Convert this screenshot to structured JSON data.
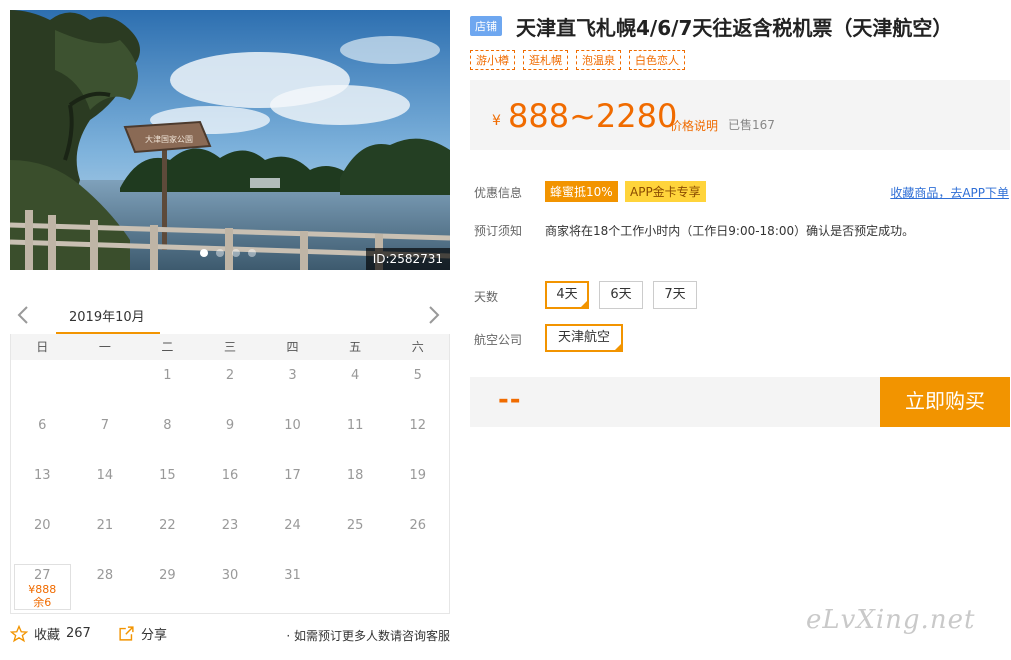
{
  "gallery": {
    "image_id": "ID:2582731",
    "sign_text": "大津国家公園",
    "slide_count": 4,
    "active_slide": 0
  },
  "calendar": {
    "month": "2019年10月",
    "weekdays": [
      "日",
      "一",
      "二",
      "三",
      "四",
      "五",
      "六"
    ],
    "cells": [
      {
        "day": ""
      },
      {
        "day": ""
      },
      {
        "day": "1"
      },
      {
        "day": "2"
      },
      {
        "day": "3"
      },
      {
        "day": "4"
      },
      {
        "day": "5"
      },
      {
        "day": "6"
      },
      {
        "day": "7"
      },
      {
        "day": "8"
      },
      {
        "day": "9"
      },
      {
        "day": "10"
      },
      {
        "day": "11"
      },
      {
        "day": "12"
      },
      {
        "day": "13"
      },
      {
        "day": "14"
      },
      {
        "day": "15"
      },
      {
        "day": "16"
      },
      {
        "day": "17"
      },
      {
        "day": "18"
      },
      {
        "day": "19"
      },
      {
        "day": "20"
      },
      {
        "day": "21"
      },
      {
        "day": "22"
      },
      {
        "day": "23"
      },
      {
        "day": "24"
      },
      {
        "day": "25"
      },
      {
        "day": "26"
      },
      {
        "day": "27",
        "price": "¥888",
        "left": "余6"
      },
      {
        "day": "28"
      },
      {
        "day": "29"
      },
      {
        "day": "30"
      },
      {
        "day": "31"
      },
      {
        "day": ""
      },
      {
        "day": ""
      }
    ]
  },
  "actions": {
    "collect_label": "收藏",
    "collect_count": "267",
    "share_label": "分享",
    "note": "· 如需预订更多人数请咨询客服"
  },
  "product": {
    "shop_badge": "店铺",
    "title": "天津直飞札幌4/6/7天往返含税机票（天津航空）",
    "tags": [
      "游小樽",
      "逛札幌",
      "泡温泉",
      "白色恋人"
    ],
    "currency": "¥",
    "price_range": "888~2280",
    "price_explain": "价格说明",
    "sold": "已售167"
  },
  "promo": {
    "label": "优惠信息",
    "bee_tag": "蜂蜜抵10%",
    "app_tag": "APP金卡专享",
    "app_link": "收藏商品，去APP下单"
  },
  "booking": {
    "label": "预订须知",
    "notice": "商家将在18个工作小时内（工作日9:00-18:00）确认是否预定成功。"
  },
  "options": {
    "days_label": "天数",
    "days": [
      {
        "label": "4天",
        "selected": true
      },
      {
        "label": "6天",
        "selected": false
      },
      {
        "label": "7天",
        "selected": false
      }
    ],
    "airline_label": "航空公司",
    "airline": {
      "label": "天津航空",
      "selected": true
    }
  },
  "purchase": {
    "total": "--",
    "buy_label": "立即购买"
  },
  "watermark": "eLvXing.net",
  "colors": {
    "accent": "#f29400",
    "price": "#f06b00",
    "link": "#2f6fd6",
    "shop_badge": "#6ea7f0"
  }
}
